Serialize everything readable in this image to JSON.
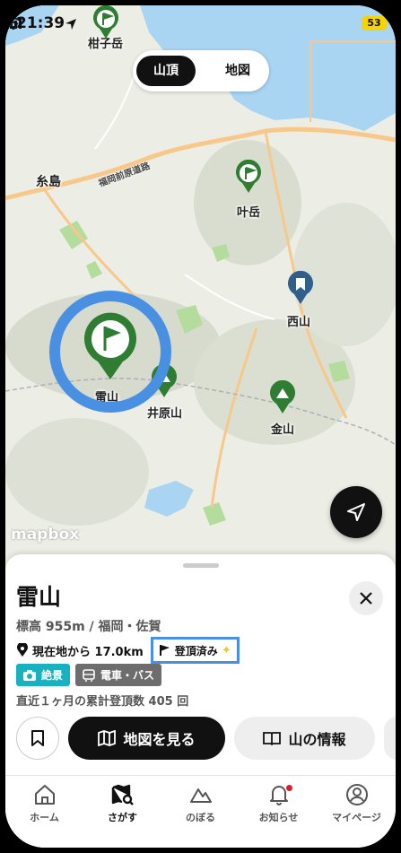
{
  "status_bar": {
    "time": "21:39",
    "battery": "53"
  },
  "map": {
    "toggle": {
      "active": "山頂",
      "other": "地図"
    },
    "labels": {
      "shikodake": "柑子岳",
      "itoshima": "糸島",
      "kanodake": "叶岳",
      "nishiyama": "西山",
      "raizan": "雷山",
      "iharayama": "井原山",
      "kanayama": "金山"
    },
    "road_label": "福岡前原道路",
    "attribution": "mapbox",
    "colors": {
      "water": "#a9d4f2",
      "road": "#f7c88a",
      "pin": "#2e7d32",
      "highlight": "#4a90e2"
    }
  },
  "sheet": {
    "name": "雷山",
    "meta": "標高 955m / 福岡・佐賀",
    "distance": "現在地から 17.0km",
    "climbed": "登頂済み",
    "tags": [
      "絶景",
      "電車・バス"
    ],
    "count": "直近１ヶ月の累計登頂数 405 回",
    "map_button": "地図を見る",
    "info_button": "山の情報"
  },
  "tabs": [
    {
      "label": "ホーム",
      "icon": "home-icon"
    },
    {
      "label": "さがす",
      "icon": "search-map-icon"
    },
    {
      "label": "のぼる",
      "icon": "mountain-icon"
    },
    {
      "label": "お知らせ",
      "icon": "bell-icon"
    },
    {
      "label": "マイページ",
      "icon": "user-icon"
    }
  ]
}
